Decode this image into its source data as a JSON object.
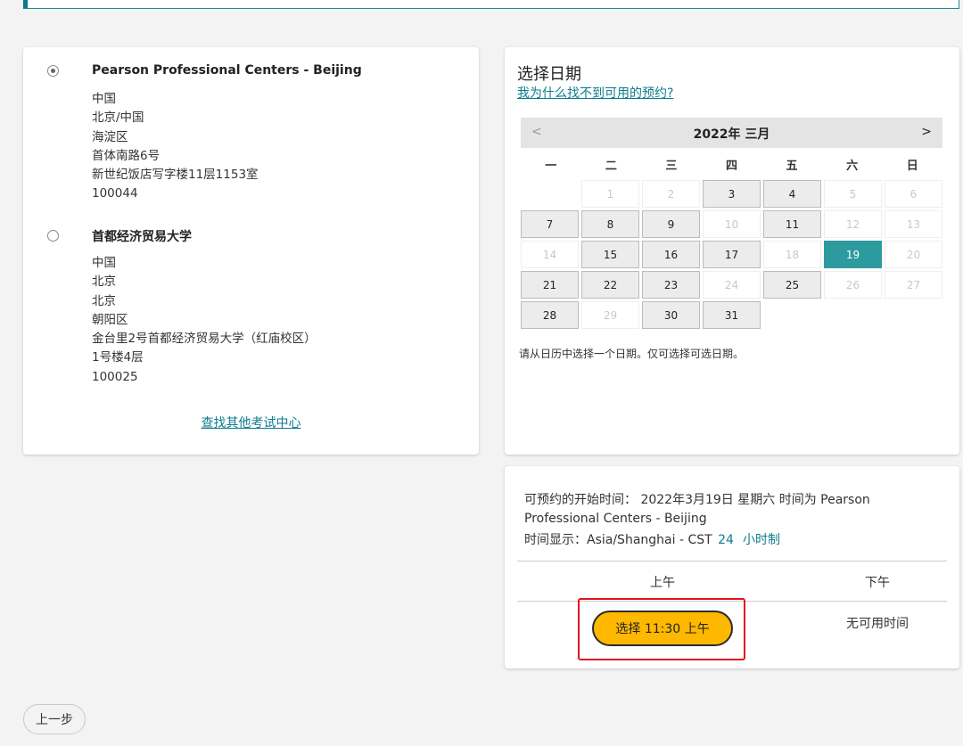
{
  "centers": [
    {
      "name": "Pearson Professional Centers - Beijing",
      "selected": true,
      "address": [
        "中国",
        "北京/中国",
        "海淀区",
        "首体南路6号",
        "新世纪饭店写字楼11层1153室",
        "100044"
      ]
    },
    {
      "name": "首都经济贸易大学",
      "selected": false,
      "address": [
        "中国",
        "北京",
        "北京",
        "朝阳区",
        "金台里2号首都经济贸易大学（红庙校区）",
        "1号楼4层",
        "100025"
      ]
    }
  ],
  "find_other_link": "查找其他考试中心",
  "date_panel": {
    "title": "选择日期",
    "why_link": "我为什么找不到可用的预约?",
    "calendar_title": "2022年 三月",
    "prev": "<",
    "next": ">",
    "weekdays": [
      "一",
      "二",
      "三",
      "四",
      "五",
      "六",
      "日"
    ],
    "days": [
      {
        "n": "",
        "s": "empty"
      },
      {
        "n": "1",
        "s": "unavail"
      },
      {
        "n": "2",
        "s": "unavail"
      },
      {
        "n": "3",
        "s": "avail"
      },
      {
        "n": "4",
        "s": "avail"
      },
      {
        "n": "5",
        "s": "unavail"
      },
      {
        "n": "6",
        "s": "unavail"
      },
      {
        "n": "7",
        "s": "avail"
      },
      {
        "n": "8",
        "s": "avail"
      },
      {
        "n": "9",
        "s": "avail"
      },
      {
        "n": "10",
        "s": "unavail"
      },
      {
        "n": "11",
        "s": "avail"
      },
      {
        "n": "12",
        "s": "unavail"
      },
      {
        "n": "13",
        "s": "unavail"
      },
      {
        "n": "14",
        "s": "unavail"
      },
      {
        "n": "15",
        "s": "avail"
      },
      {
        "n": "16",
        "s": "avail"
      },
      {
        "n": "17",
        "s": "avail"
      },
      {
        "n": "18",
        "s": "unavail"
      },
      {
        "n": "19",
        "s": "selected"
      },
      {
        "n": "20",
        "s": "unavail"
      },
      {
        "n": "21",
        "s": "avail"
      },
      {
        "n": "22",
        "s": "avail"
      },
      {
        "n": "23",
        "s": "avail"
      },
      {
        "n": "24",
        "s": "unavail"
      },
      {
        "n": "25",
        "s": "avail"
      },
      {
        "n": "26",
        "s": "unavail"
      },
      {
        "n": "27",
        "s": "unavail"
      },
      {
        "n": "28",
        "s": "avail"
      },
      {
        "n": "29",
        "s": "unavail"
      },
      {
        "n": "30",
        "s": "avail"
      },
      {
        "n": "31",
        "s": "avail"
      }
    ],
    "note": "请从日历中选择一个日期。仅可选择可选日期。"
  },
  "time_panel": {
    "info": "可预约的开始时间：  2022年3月19日 星期六 时间为 Pearson Professional Centers - Beijing",
    "tz_label": "时间显示：",
    "tz_value": "Asia/Shanghai - CST",
    "tz_24": "24",
    "tz_unit": "小时制",
    "am_label": "上午",
    "pm_label": "下午",
    "select_button": "选择 11:30 上午",
    "no_time": "无可用时间"
  },
  "back_button": "上一步",
  "colors": {
    "accent": "#0f7c8c",
    "selected_day": "#2c9a9e",
    "select_button": "#ffb800",
    "highlight": "#e3141b"
  }
}
